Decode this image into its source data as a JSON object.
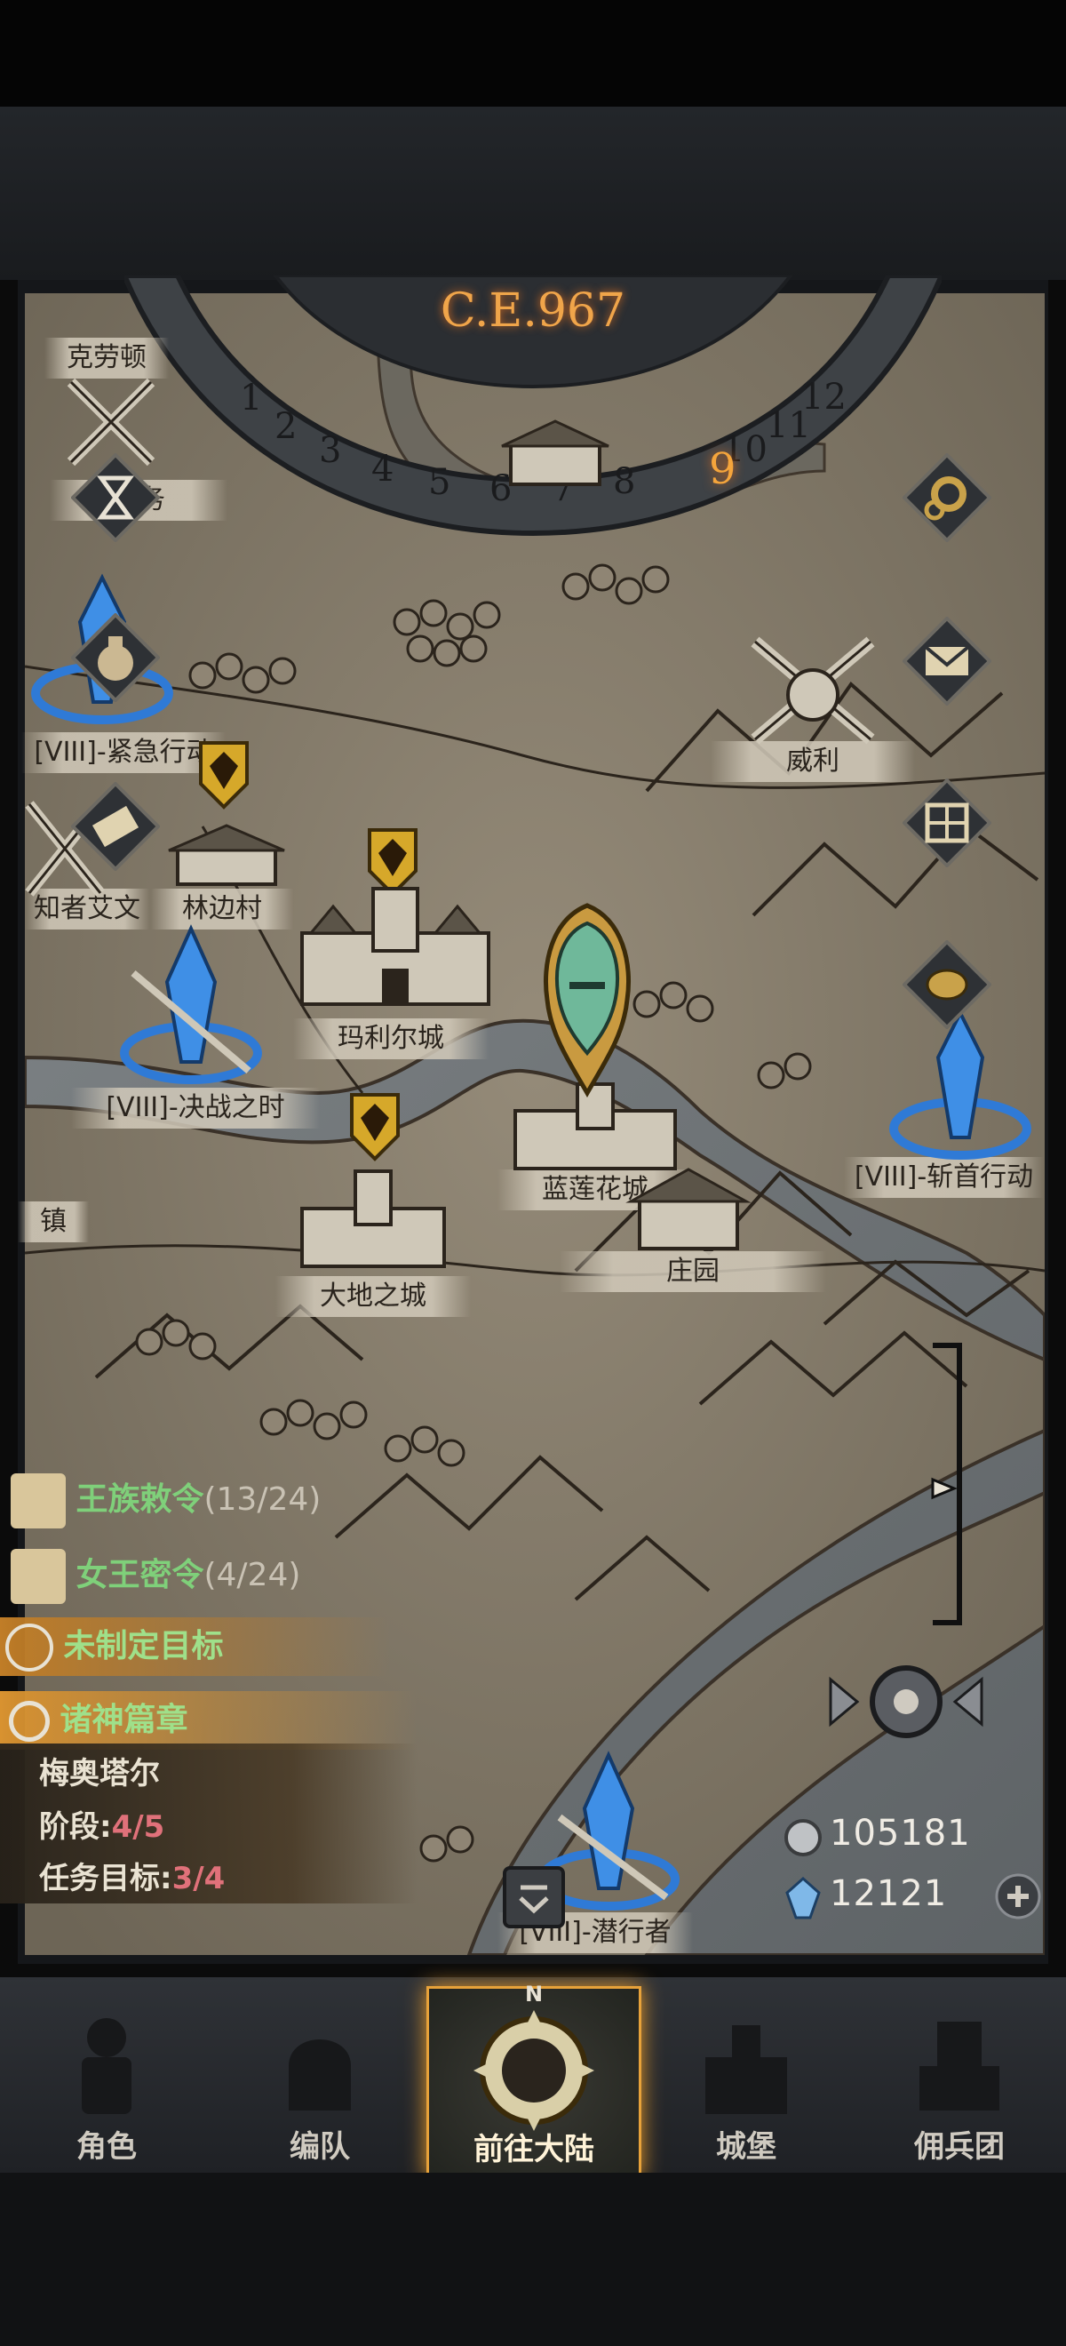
{
  "calendar": {
    "era": "C.E.967",
    "months": [
      "1",
      "2",
      "3",
      "4",
      "5",
      "6",
      "7",
      "8",
      "9",
      "10",
      "11",
      "12"
    ],
    "current_month": "9"
  },
  "map": {
    "locations": [
      {
        "id": "kelao",
        "label": "克劳顿"
      },
      {
        "id": "task",
        "label": "任务"
      },
      {
        "id": "urgent",
        "label": "[VIII]-紧急行动"
      },
      {
        "id": "zhizhe",
        "label": "知者艾文"
      },
      {
        "id": "linbian",
        "label": "林边村"
      },
      {
        "id": "mali",
        "label": "玛利尔城"
      },
      {
        "id": "juezhan",
        "label": "[VIII]-决战之时"
      },
      {
        "id": "weili",
        "label": "威利"
      },
      {
        "id": "lanlian",
        "label": "蓝莲花城"
      },
      {
        "id": "zhuangyuan",
        "label": "庄园"
      },
      {
        "id": "dadi",
        "label": "大地之城"
      },
      {
        "id": "zhen",
        "label": "镇"
      },
      {
        "id": "zhanshou",
        "label": "[VIII]-斩首行动"
      },
      {
        "id": "qianxing",
        "label": "[VIII]-潜行者"
      }
    ]
  },
  "side_buttons": {
    "settings_icon": "gear-icon",
    "mail_icon": "envelope-icon",
    "grid_icon": "grid-icon",
    "coin_icon": "coin-icon"
  },
  "quests": [
    {
      "name": "王族敕令",
      "progress": "(13/24)"
    },
    {
      "name": "女王密令",
      "progress": "(4/24)"
    }
  ],
  "target": {
    "label": "未制定目标"
  },
  "chapter": {
    "title": "诸神篇章",
    "boss": "梅奥塔尔",
    "stage_label": "阶段:",
    "stage_value": "4/5",
    "goal_label": "任务目标:",
    "goal_value": "3/4"
  },
  "resources": {
    "silver": "105181",
    "crystal": "12121"
  },
  "tabs": [
    {
      "label": "角色",
      "active": false
    },
    {
      "label": "编队",
      "active": false
    },
    {
      "label": "前往大陆",
      "active": true
    },
    {
      "label": "城堡",
      "active": false
    },
    {
      "label": "佣兵团",
      "active": false
    }
  ],
  "compass_letter": "N",
  "colors": {
    "accent": "#e7a23a",
    "quest_green": "#7fd07a",
    "progress_red": "#e0717a",
    "parchment": "#8a8070"
  }
}
